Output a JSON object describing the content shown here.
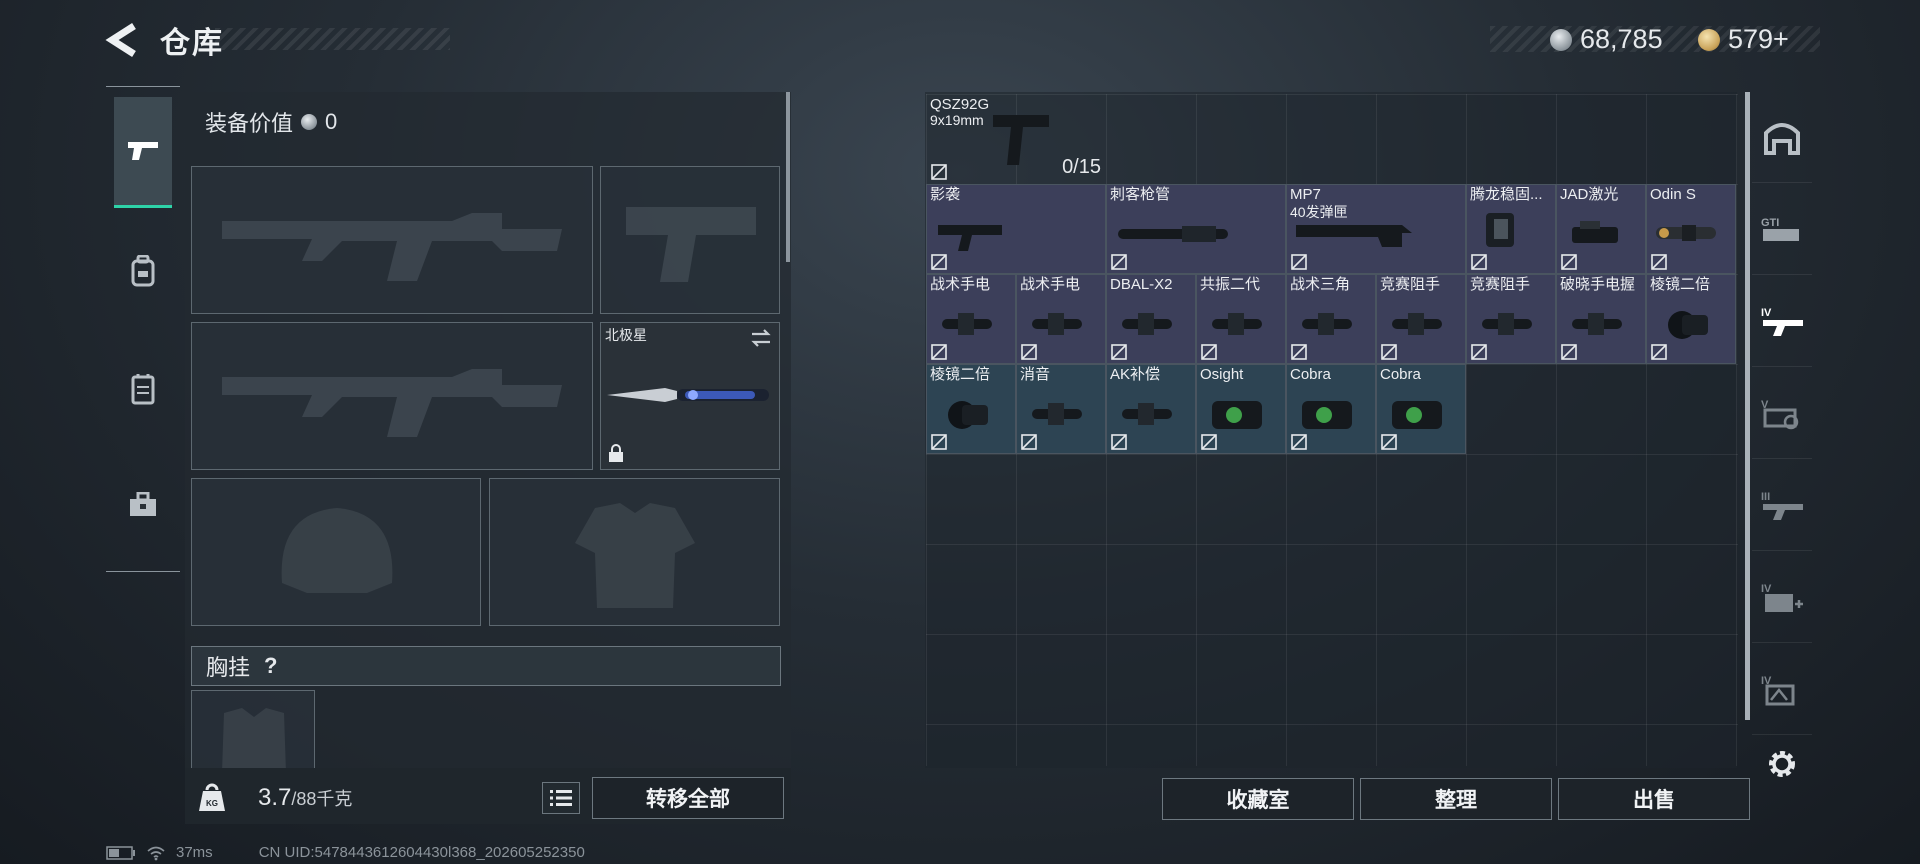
{
  "header": {
    "title": "仓库",
    "currency_silver": "68,785",
    "currency_gold": "579+"
  },
  "colors": {
    "accent": "#2ed3a8",
    "rarity_purple": "#3c3f5a",
    "rarity_blue": "#2d4453",
    "rarity_gray": "#3a4047"
  },
  "loadout": {
    "equipment_value_label": "装备价值",
    "equipment_value": "0",
    "melee_slot_name": "北极星",
    "chest_rig_label": "胸挂",
    "chest_rig_help": "?",
    "weight": "3.7",
    "weight_capacity": "/88千克",
    "transfer_all_label": "转移全部"
  },
  "left_tabs": [
    "gun-icon",
    "backpack-icon",
    "vest-icon",
    "toolbox-icon"
  ],
  "stash": {
    "ammo": {
      "name": "QSZ92G",
      "caliber": "9x19mm",
      "count": "0/15"
    },
    "items": [
      {
        "name": "影袭",
        "rarity": "purple"
      },
      {
        "name": "刺客枪管",
        "rarity": "purple"
      },
      {
        "name": "MP7",
        "sub": "40发弹匣",
        "rarity": "purple"
      },
      {
        "name": "腾龙稳固...",
        "rarity": "purple"
      },
      {
        "name": "JAD激光",
        "rarity": "purple"
      },
      {
        "name": "Odin S",
        "rarity": "purple"
      },
      {
        "name": "战术手电",
        "rarity": "purple"
      },
      {
        "name": "战术手电",
        "rarity": "purple"
      },
      {
        "name": "DBAL-X2",
        "rarity": "purple"
      },
      {
        "name": "共振二代",
        "rarity": "purple"
      },
      {
        "name": "战术三角",
        "rarity": "purple"
      },
      {
        "name": "竞赛阻手",
        "rarity": "purple"
      },
      {
        "name": "竞赛阻手",
        "rarity": "purple"
      },
      {
        "name": "破晓手电握",
        "rarity": "purple"
      },
      {
        "name": "棱镜二倍",
        "rarity": "purple"
      },
      {
        "name": "棱镜二倍",
        "rarity": "blue"
      },
      {
        "name": "消音",
        "rarity": "blue"
      },
      {
        "name": "AK补偿",
        "rarity": "blue"
      },
      {
        "name": "Osight",
        "rarity": "blue"
      },
      {
        "name": "Cobra",
        "rarity": "blue"
      },
      {
        "name": "Cobra",
        "rarity": "blue"
      }
    ]
  },
  "actions": {
    "collection": "收藏室",
    "sort": "整理",
    "sell": "出售"
  },
  "right_tabs": [
    "bunker-icon",
    "gti-icon",
    "tier4-weapon-icon",
    "tier5-gear-icon",
    "tier3-weapon-icon",
    "tier4-medical-icon",
    "tier4-misc-icon",
    "settings-icon"
  ],
  "status": {
    "ping": "37ms",
    "uid": "CN UID:5478443612604430l368_202605252350"
  }
}
